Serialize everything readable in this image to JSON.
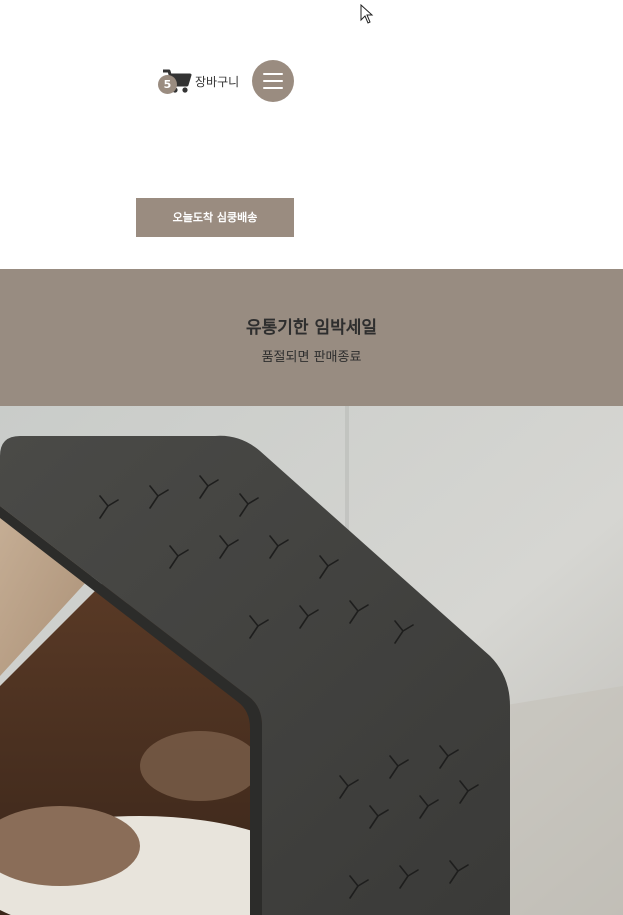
{
  "header": {
    "cart": {
      "count": "5",
      "label": "장바구니",
      "icon": "cart-icon"
    },
    "menu": {
      "icon": "hamburger-menu-icon"
    },
    "promo_button_label": "오늘도착 심쿵배송"
  },
  "banner": {
    "title": "유통기한 임박세일",
    "subtitle": "품절되면 판매종료"
  },
  "colors": {
    "accent": "#9a8c80",
    "banner_bg": "#988c81",
    "text": "#2e2e2e"
  }
}
